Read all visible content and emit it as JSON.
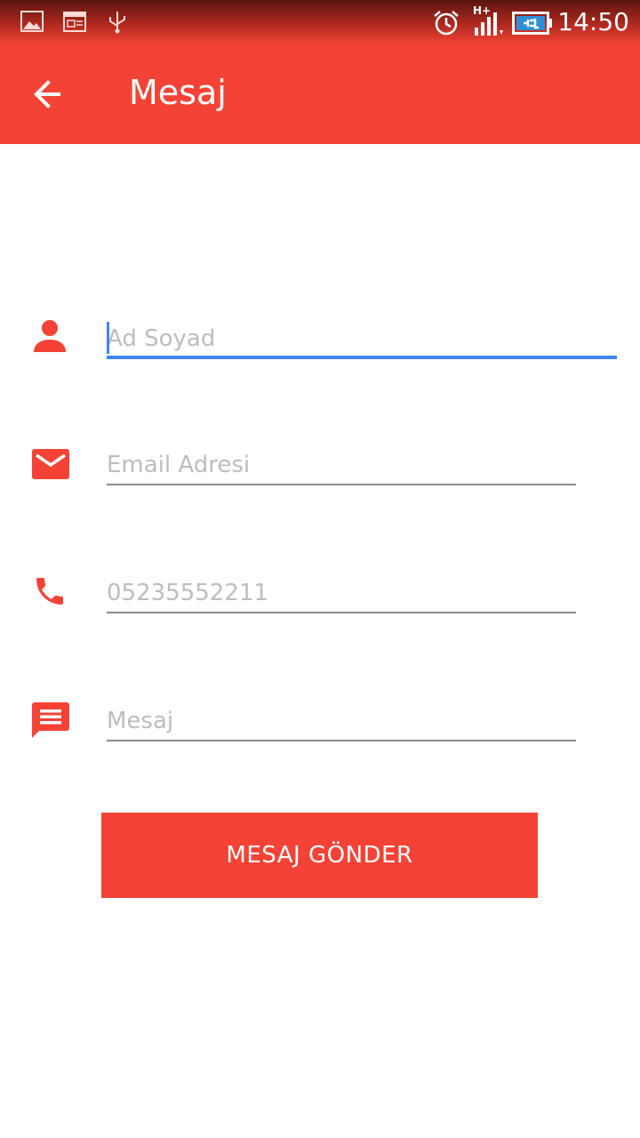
{
  "status_bar": {
    "time": "14:50",
    "left_icons": [
      "gallery-icon",
      "calendar-icon",
      "usb-icon"
    ],
    "right_icons": [
      "alarm-icon",
      "signal-hplus-icon",
      "battery-charging-icon"
    ],
    "network_label": "H+"
  },
  "app_bar": {
    "title": "Mesaj",
    "back_icon": "arrow-back-icon",
    "color": "#f44336"
  },
  "form": {
    "name": {
      "placeholder": "Ad Soyad",
      "icon": "person-icon",
      "focused": true
    },
    "email": {
      "placeholder": "Email Adresi",
      "icon": "mail-icon"
    },
    "phone": {
      "placeholder": "05235552211",
      "icon": "phone-icon"
    },
    "message": {
      "placeholder": "Mesaj",
      "icon": "message-icon"
    },
    "submit_label": "MESAJ GÖNDER"
  },
  "colors": {
    "accent": "#f44336",
    "focus": "#4285f4",
    "placeholder": "#bdbdbd"
  }
}
